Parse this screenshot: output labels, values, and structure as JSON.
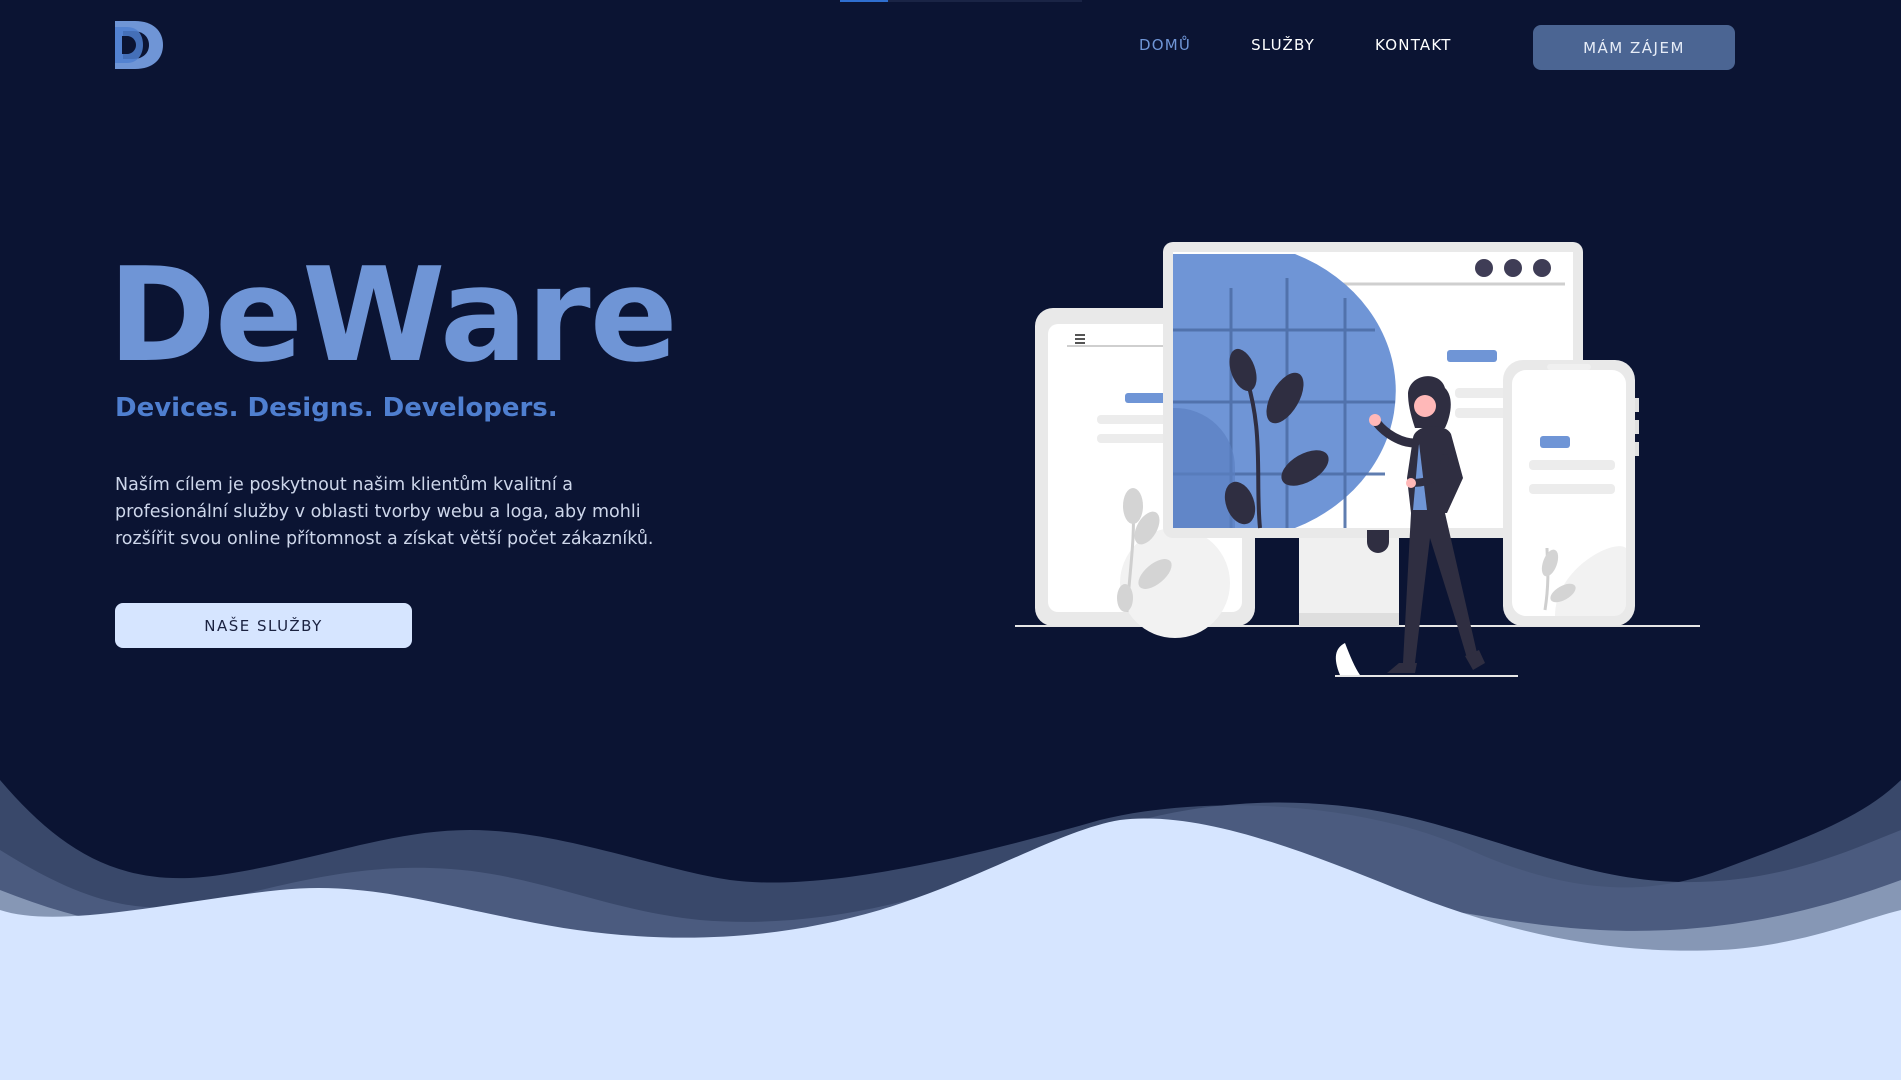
{
  "brand": {
    "logo_letter": "D"
  },
  "nav": {
    "items": [
      {
        "label": "DOMŮ",
        "active": true
      },
      {
        "label": "SLUŽBY",
        "active": false
      },
      {
        "label": "KONTAKT",
        "active": false
      }
    ],
    "cta_label": "MÁM ZÁJEM"
  },
  "hero": {
    "title": "DeWare",
    "subtitle": "Devices. Designs. Developers.",
    "description": "Naším cílem je poskytnout našim klientům kvalitní a profesionální služby v oblasti tvorby webu a loga, aby mohli rozšířit svou online přítomnost a získat větší počet zákazníků.",
    "button_label": "NAŠE SLUŽBY"
  },
  "icons": {
    "logo": "d-logo-icon",
    "illustration": "devices-woman-illustration"
  },
  "colors": {
    "background": "#0b1433",
    "accent": "#6f95d6",
    "subtitle": "#4f7fd0",
    "cta_top": "#4b6593",
    "cta_main": "#d6e5ff",
    "wave_light": "#d6e5ff"
  }
}
